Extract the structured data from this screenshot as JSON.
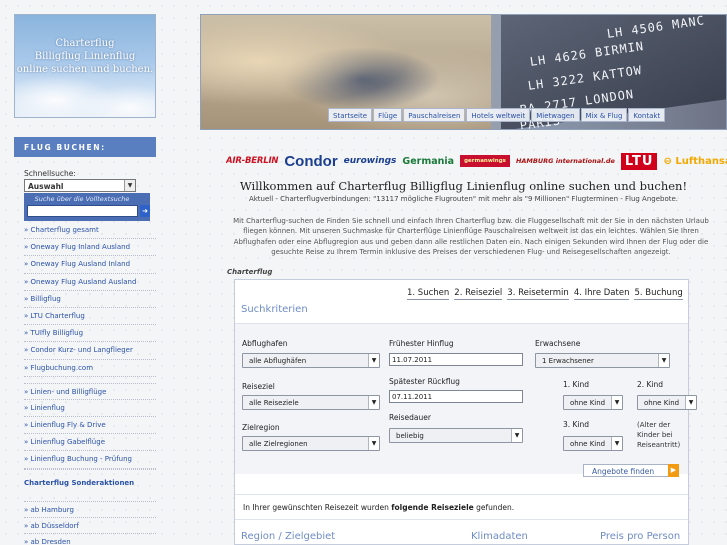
{
  "logo": {
    "lines": [
      "Charterflug",
      "Billigflug Linienflug",
      "online suchen und buchen."
    ]
  },
  "sidebar": {
    "heading": "FLUG BUCHEN:",
    "quick_search_label": "Schnellsuche:",
    "quick_select": "Auswahl",
    "fulltext_hint": "Suche über die Volltextsuche",
    "fulltext_value": "",
    "items": [
      "» Charterflug gesamt",
      "» Oneway Flug Inland Ausland",
      "» Oneway Flug Ausland Inland",
      "» Oneway Flug Ausland Ausland",
      "» Billigflug",
      "» LTU Charterflug",
      "» TUIfly Billigflug",
      "» Condor Kurz- und Langflieger",
      "» Flugbuchung.com",
      "» Linien- und Billigflüge",
      "» Linienflug",
      "» Linienflug Fly & Drive",
      "» Linienflug Gabelflüge",
      "» Linienflug Buchung - Prüfung"
    ],
    "special_heading": "Charterflug Sonderaktionen",
    "special_items": [
      "» ab Hamburg",
      "» ab Düsseldorf",
      "» ab Dresden"
    ]
  },
  "banner": {
    "board_lines": [
      "LH 4506  MANC",
      "LH 4626  BIRMIN",
      "LH 3222  KATTOW",
      "BA 2717  LONDON",
      "         PARIS"
    ],
    "nav": [
      "Startseite",
      "Flüge",
      "Pauschalreisen",
      "Hotels weltweit",
      "Mietwagen",
      "Mix & Flug",
      "Kontakt"
    ]
  },
  "airlines": {
    "airberlin": "AIR-BERLIN",
    "condor": "Condor",
    "eurowings": "eurowings",
    "germania": "Germania",
    "germanwings": "germanwings",
    "hamburg": "HAMBURG international.de",
    "ltu": "LTU",
    "lufthansa": "Lufthansa"
  },
  "welcome": {
    "title": "Willkommen auf Charterflug Billigflug Linienflug online suchen und buchen!",
    "subtitle": "Aktuell - Charterflugverbindungen: \"13117 mögliche Flugrouten\" mit mehr als \"9 Millionen\" Flugterminen - Flug Angebote.",
    "body": "Mit Charterflug-suchen de Finden Sie schnell und einfach Ihren Charterflug bzw. die Fluggesellschaft mit der Sie in den nächsten Urlaub fliegen können. Mit unseren Suchmaske für Charterflüge Linienflüge Pauschalreisen weltweit ist das ein leichtes. Wählen Sie Ihren Abflughafen oder eine Abflugregion aus und geben dann alle restlichen Daten ein. Nach einigen Sekunden wird Ihnen der Flug oder die gesuchte Reise zu Ihrem Termin inklusive des Preises der verschiedenen Flug- und Reisegesellschaften angezeigt.",
    "section_label": "Charterflug"
  },
  "search": {
    "steps": [
      "1. Suchen",
      "2. Reiseziel",
      "3. Reisetermin",
      "4. Ihre Daten",
      "5. Buchung"
    ],
    "title": "Suchkriterien",
    "departure_label": "Abflughafen",
    "departure_value": "alle Abflughäfen",
    "destination_label": "Reiseziel",
    "destination_value": "alle Reiseziele",
    "region_label": "Zielregion",
    "region_value": "alle Zielregionen",
    "earliest_label": "Frühester Hinflug",
    "earliest_value": "11.07.2011",
    "latest_label": "Spätester Rückflug",
    "latest_value": "07.11.2011",
    "duration_label": "Reisedauer",
    "duration_value": "beliebig",
    "adults_label": "Erwachsene",
    "adults_value": "1 Erwachsener",
    "child1_label": "1. Kind",
    "child1_value": "ohne Kind",
    "child2_label": "2. Kind",
    "child2_value": "ohne Kind",
    "child3_label": "3. Kind",
    "child3_value": "ohne Kind",
    "child_note": "(Alter der Kinder bei Reiseantritt)",
    "find_button": "Angebote finden",
    "result_prefix": "In Ihrer gewünschten Reisezeit wurden ",
    "result_bold": "folgende Reiseziele",
    "result_suffix": " gefunden.",
    "col_region": "Region / Zielgebiet",
    "col_climate": "Klimadaten",
    "col_price": "Preis pro Person"
  },
  "colors": {
    "accent": "#5a7fc0",
    "link": "#2a52a8",
    "orange": "#f29a12"
  }
}
